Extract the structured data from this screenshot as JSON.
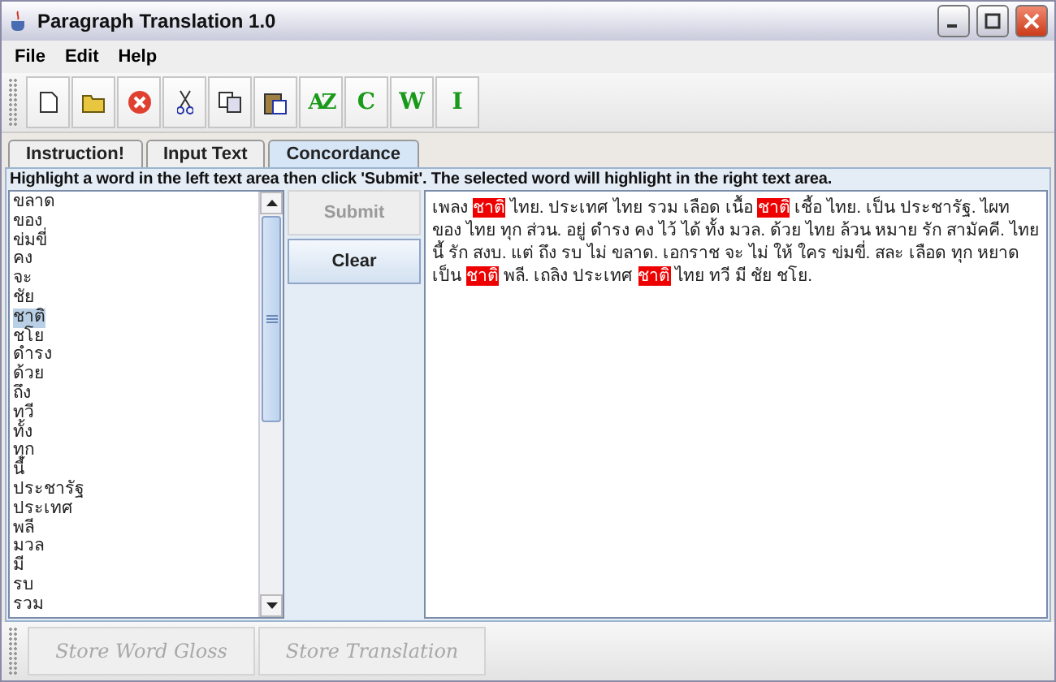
{
  "window": {
    "title": "Paragraph Translation 1.0"
  },
  "menu": [
    "File",
    "Edit",
    "Help"
  ],
  "toolbar": [
    {
      "kind": "new"
    },
    {
      "kind": "open"
    },
    {
      "kind": "stop"
    },
    {
      "kind": "cut"
    },
    {
      "kind": "copy"
    },
    {
      "kind": "paste"
    },
    {
      "kind": "sort",
      "label": "AZ"
    },
    {
      "kind": "letter",
      "label": "C"
    },
    {
      "kind": "letter",
      "label": "W"
    },
    {
      "kind": "letter",
      "label": "I"
    }
  ],
  "tabs": [
    {
      "label": "Instruction!",
      "selected": false
    },
    {
      "label": "Input Text",
      "selected": false
    },
    {
      "label": "Concordance",
      "selected": true
    }
  ],
  "instruction": "Highlight a word in the left text area then click 'Submit'. The selected word will highlight in the right text area.",
  "word_list": [
    {
      "text": "ขลาด",
      "selected": false
    },
    {
      "text": "ของ",
      "selected": false
    },
    {
      "text": "ข่มขี่",
      "selected": false
    },
    {
      "text": "คง",
      "selected": false
    },
    {
      "text": "จะ",
      "selected": false
    },
    {
      "text": "ชัย",
      "selected": false
    },
    {
      "text": "ชาติ",
      "selected": true
    },
    {
      "text": "ชโย",
      "selected": false
    },
    {
      "text": "ดำรง",
      "selected": false
    },
    {
      "text": "ด้วย",
      "selected": false
    },
    {
      "text": "ถึง",
      "selected": false
    },
    {
      "text": "ทวี",
      "selected": false
    },
    {
      "text": "ทั้ง",
      "selected": false
    },
    {
      "text": "ทุก",
      "selected": false
    },
    {
      "text": "นี้",
      "selected": false
    },
    {
      "text": "ประชารัฐ",
      "selected": false
    },
    {
      "text": "ประเทศ",
      "selected": false
    },
    {
      "text": "พลี",
      "selected": false
    },
    {
      "text": "มวล",
      "selected": false
    },
    {
      "text": "มี",
      "selected": false
    },
    {
      "text": "รบ",
      "selected": false
    },
    {
      "text": "รวม",
      "selected": false
    }
  ],
  "buttons": [
    {
      "label": "Submit",
      "disabled": true
    },
    {
      "label": "Clear",
      "disabled": false
    }
  ],
  "text_segments": [
    {
      "text": "เพลง",
      "highlighted": false
    },
    {
      "text": "ชาติ",
      "highlighted": true
    },
    {
      "text": "ไทย. ประเทศ ไทย รวม เลือด เนื้อ",
      "highlighted": false
    },
    {
      "text": "ชาติ",
      "highlighted": true
    },
    {
      "text": "เชื้อ ไทย. เป็น ประชารัฐ. ไผท ของ ไทย ทุก ส่วน. อยู่ ดำรง คง ไว้ ได้ ทั้ง มวล. ด้วย ไทย ล้วน หมาย รัก สามัคคี. ไทย นี้ รัก สงบ. แต่ ถึง รบ ไม่ ขลาด. เอกราช จะ ไม่ ให้ ใคร ข่มขี่. สละ เลือด ทุก หยาด เป็น",
      "highlighted": false
    },
    {
      "text": "ชาติ",
      "highlighted": true
    },
    {
      "text": "พลี. เถลิง ประเทศ",
      "highlighted": false
    },
    {
      "text": "ชาติ",
      "highlighted": true
    },
    {
      "text": "ไทย ทวี มี ชัย ชโย.",
      "highlighted": false
    }
  ],
  "bottom_buttons": [
    {
      "label": "Store Word Gloss",
      "disabled": true
    },
    {
      "label": "Store Translation",
      "disabled": true
    }
  ]
}
